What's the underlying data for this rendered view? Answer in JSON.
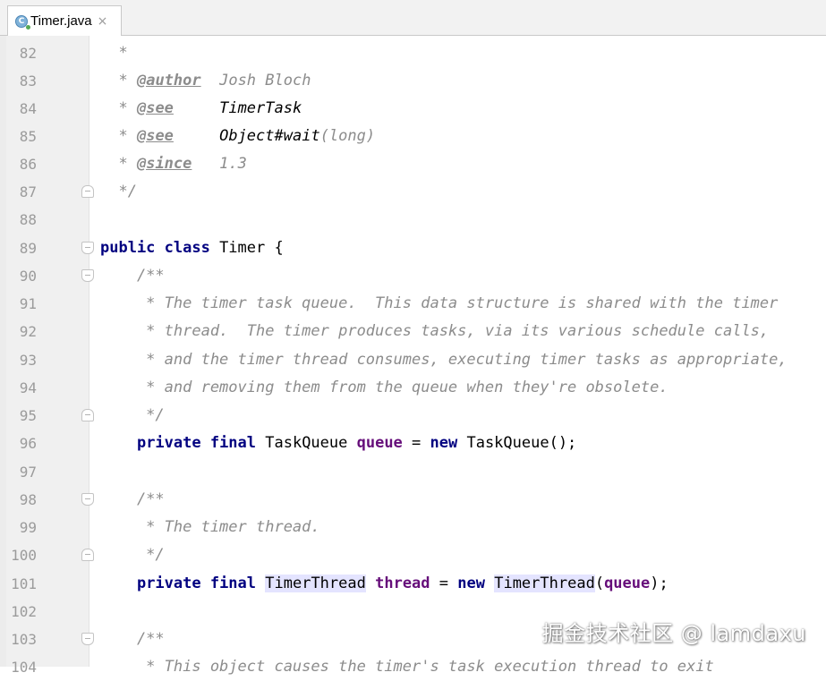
{
  "tab": {
    "filename": "Timer.java",
    "close": "×",
    "icon": "java-class-icon"
  },
  "lines": {
    "l82": {
      "num": "82",
      "t": "*"
    },
    "l83": {
      "num": "83",
      "star": "* ",
      "tag": "@author",
      "val": "  Josh Bloch"
    },
    "l84": {
      "num": "84",
      "star": "* ",
      "tag": "@see",
      "val": "     TimerTask"
    },
    "l85": {
      "num": "85",
      "star": "* ",
      "tag": "@see",
      "val": "     Object#wait",
      "val2": "(long)"
    },
    "l86": {
      "num": "86",
      "star": "* ",
      "tag": "@since",
      "val": "   1.3"
    },
    "l87": {
      "num": "87",
      "t": "*/"
    },
    "l88": {
      "num": "88"
    },
    "l89": {
      "num": "89",
      "kw": "public class",
      "rest": " Timer {"
    },
    "l90": {
      "num": "90",
      "t": "    /**"
    },
    "l91": {
      "num": "91",
      "t": "     * The timer task queue.  This data structure is shared with the timer"
    },
    "l92": {
      "num": "92",
      "t": "     * thread.  The timer produces tasks, via its various schedule calls,"
    },
    "l93": {
      "num": "93",
      "t": "     * and the timer thread consumes, executing timer tasks as appropriate,"
    },
    "l94": {
      "num": "94",
      "t": "     * and removing them from the queue when they're obsolete."
    },
    "l95": {
      "num": "95",
      "t": "     */"
    },
    "l96": {
      "num": "96",
      "indent": "    ",
      "kw": "private final",
      "type": " TaskQueue ",
      "field": "queue",
      "eq": " = ",
      "kw2": "new",
      "rest": " TaskQueue();"
    },
    "l97": {
      "num": "97"
    },
    "l98": {
      "num": "98",
      "t": "    /**"
    },
    "l99": {
      "num": "99",
      "t": "     * The timer thread."
    },
    "l100": {
      "num": "100",
      "t": "     */"
    },
    "l101": {
      "num": "101",
      "indent": "    ",
      "kw": "private final",
      "sp": " ",
      "type": "TimerThread",
      "sp2": " ",
      "field": "thread",
      "eq": " = ",
      "kw2": "new",
      "sp3": " ",
      "type2": "TimerThread",
      "paren": "(",
      "arg": "queue",
      "rest": ");"
    },
    "l102": {
      "num": "102"
    },
    "l103": {
      "num": "103",
      "t": "    /**"
    },
    "l104": {
      "num": "104",
      "t": "     * This object causes the timer's task execution thread to exit"
    }
  },
  "watermark": "掘金技术社区 @ lamdaxu"
}
